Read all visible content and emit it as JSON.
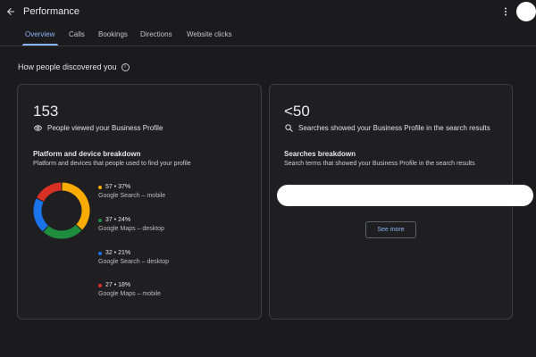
{
  "header": {
    "title": "Performance"
  },
  "tabs": [
    {
      "label": "Overview"
    },
    {
      "label": "Calls"
    },
    {
      "label": "Bookings"
    },
    {
      "label": "Directions"
    },
    {
      "label": "Website clicks"
    }
  ],
  "section": {
    "title": "How people discovered you"
  },
  "left_card": {
    "count": "153",
    "count_label": "People viewed your Business Profile",
    "breakdown_title": "Platform and device breakdown",
    "breakdown_desc": "Platform and devices that people used to find your profile",
    "legend": [
      {
        "stat": "57 • 37%",
        "label": "Google Search – mobile",
        "color": "#f9ab00",
        "value": 57
      },
      {
        "stat": "37 • 24%",
        "label": "Google Maps – desktop",
        "color": "#1e8e3e",
        "value": 37
      },
      {
        "stat": "32 • 21%",
        "label": "Google Search – desktop",
        "color": "#1a73e8",
        "value": 32
      },
      {
        "stat": "27 • 18%",
        "label": "Google Maps – mobile",
        "color": "#d93025",
        "value": 27
      }
    ]
  },
  "right_card": {
    "count": "<50",
    "count_label": "Searches showed your Business Profile in the search results",
    "breakdown_title": "Searches breakdown",
    "breakdown_desc": "Search terms that showed your Business Profile in the search results",
    "see_more_label": "See more"
  },
  "icons": {
    "back": "arrow-left-icon",
    "more": "more-vert-icon",
    "info": "info-icon",
    "views": "eye-icon",
    "search": "search-icon"
  }
}
